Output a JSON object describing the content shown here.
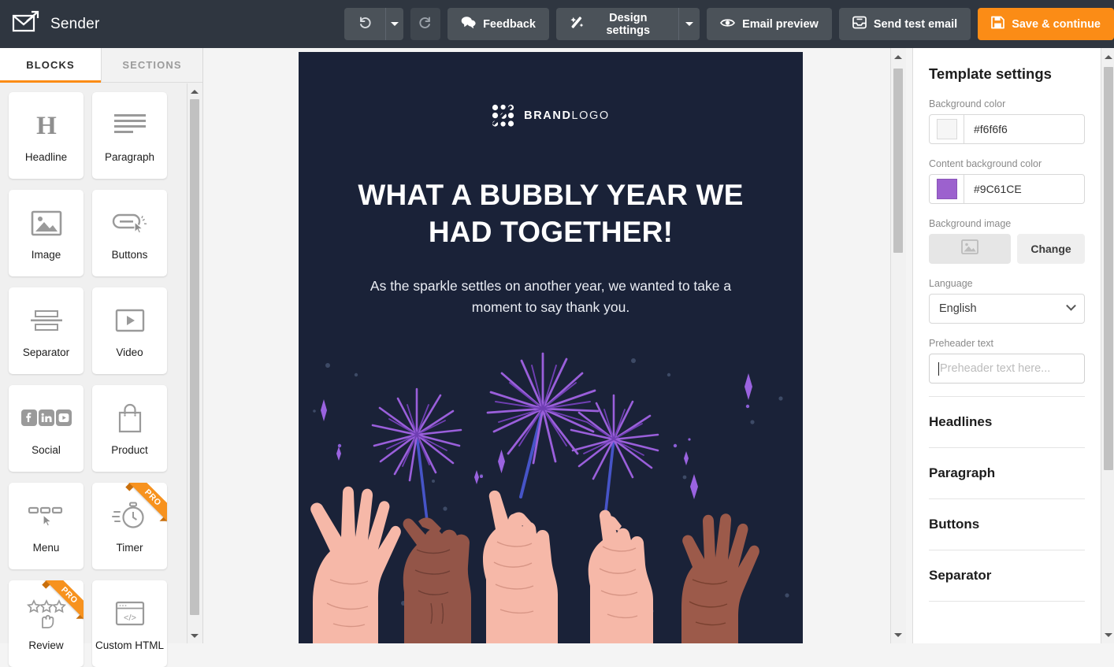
{
  "app": {
    "name": "Sender",
    "logo_icon": "envelope-arrow-icon"
  },
  "toolbar": {
    "undo": {
      "label": "",
      "icon": "undo-icon"
    },
    "undo_caret": {
      "icon": "caret-down-icon"
    },
    "redo": {
      "label": "",
      "icon": "redo-icon"
    },
    "feedback": {
      "label": "Feedback",
      "icon": "chat-bubbles-icon"
    },
    "design_settings": {
      "label": "Design settings",
      "icon": "magic-wand-icon",
      "caret": "caret-down-icon"
    },
    "email_preview": {
      "label": "Email preview",
      "icon": "eye-icon"
    },
    "send_test": {
      "label": "Send test email",
      "icon": "inbox-icon"
    },
    "save_continue": {
      "label": "Save & continue",
      "icon": "floppy-disk-icon",
      "color": "#fb8c16"
    }
  },
  "left_panel": {
    "tabs": [
      {
        "label": "BLOCKS",
        "active": true
      },
      {
        "label": "SECTIONS",
        "active": false
      }
    ],
    "blocks": [
      {
        "label": "Headline",
        "icon": "headline-h-icon",
        "pro": false
      },
      {
        "label": "Paragraph",
        "icon": "paragraph-lines-icon",
        "pro": false
      },
      {
        "label": "Image",
        "icon": "image-icon",
        "pro": false
      },
      {
        "label": "Buttons",
        "icon": "button-cursor-icon",
        "pro": false
      },
      {
        "label": "Separator",
        "icon": "separator-icon",
        "pro": false
      },
      {
        "label": "Video",
        "icon": "video-play-icon",
        "pro": false
      },
      {
        "label": "Social",
        "icon": "social-networks-icon",
        "pro": false
      },
      {
        "label": "Product",
        "icon": "shopping-bag-icon",
        "pro": false
      },
      {
        "label": "Menu",
        "icon": "menu-cursor-icon",
        "pro": false
      },
      {
        "label": "Timer",
        "icon": "stopwatch-icon",
        "pro": true
      },
      {
        "label": "Review",
        "icon": "stars-hand-icon",
        "pro": true
      },
      {
        "label": "Custom HTML",
        "icon": "code-window-icon",
        "pro": false
      }
    ],
    "pro_badge": "PRO"
  },
  "email": {
    "logo": {
      "brand": "BRAND",
      "logo": "LOGO",
      "mark_icon": "dot-grid-icon"
    },
    "headline": "WHAT A BUBBLY YEAR WE HAD TOGETHER!",
    "paragraph": "As the sparkle settles on another year, we wanted to take a moment to say thank you.",
    "illustration": "raised-hands-sparklers-illustration",
    "background_color": "#1a2238"
  },
  "right_panel": {
    "title": "Template settings",
    "background_color": {
      "label": "Background color",
      "value": "#f6f6f6",
      "swatch": "#f6f6f6"
    },
    "content_background_color": {
      "label": "Content background color",
      "value": "#9C61CE",
      "swatch": "#9C61CE"
    },
    "background_image": {
      "label": "Background image",
      "change_label": "Change",
      "icon": "image-placeholder-icon"
    },
    "language": {
      "label": "Language",
      "value": "English",
      "icon": "chevron-down-icon"
    },
    "preheader": {
      "label": "Preheader text",
      "value": "",
      "placeholder": "Preheader text here..."
    },
    "sections": [
      {
        "label": "Headlines"
      },
      {
        "label": "Paragraph"
      },
      {
        "label": "Buttons"
      },
      {
        "label": "Separator"
      }
    ]
  }
}
